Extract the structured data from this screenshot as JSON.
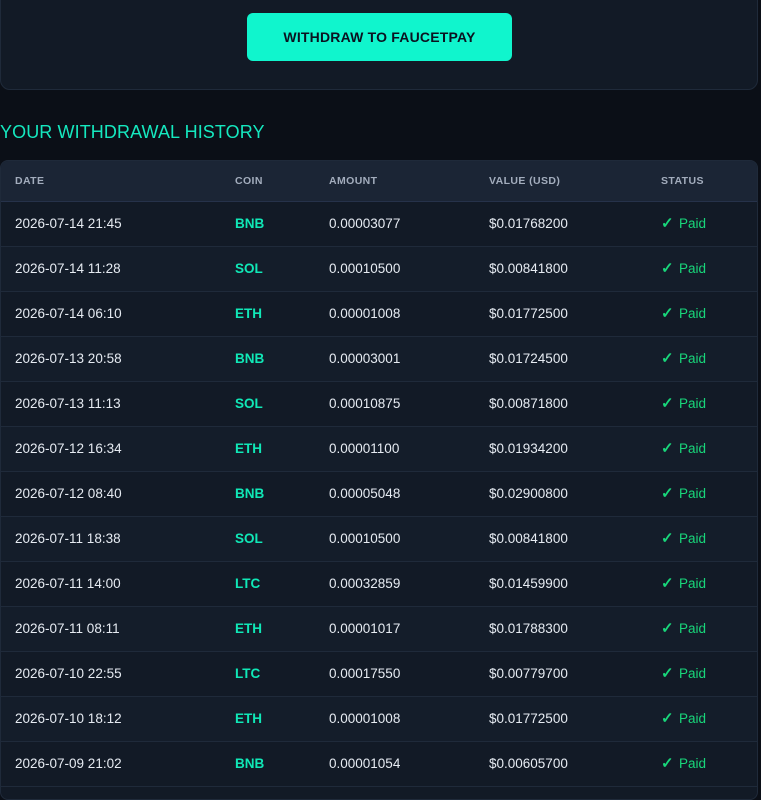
{
  "withdraw": {
    "button_label": "WITHDRAW TO FAUCETPAY"
  },
  "history": {
    "title": "YOUR WITHDRAWAL HISTORY",
    "columns": [
      "DATE",
      "COIN",
      "AMOUNT",
      "VALUE (USD)",
      "STATUS"
    ],
    "check_icon": "✓",
    "rows": [
      {
        "date": "2026-07-14 21:45",
        "coin": "BNB",
        "amount": "0.00003077",
        "value": "$0.01768200",
        "status": "Paid"
      },
      {
        "date": "2026-07-14 11:28",
        "coin": "SOL",
        "amount": "0.00010500",
        "value": "$0.00841800",
        "status": "Paid"
      },
      {
        "date": "2026-07-14 06:10",
        "coin": "ETH",
        "amount": "0.00001008",
        "value": "$0.01772500",
        "status": "Paid"
      },
      {
        "date": "2026-07-13 20:58",
        "coin": "BNB",
        "amount": "0.00003001",
        "value": "$0.01724500",
        "status": "Paid"
      },
      {
        "date": "2026-07-13 11:13",
        "coin": "SOL",
        "amount": "0.00010875",
        "value": "$0.00871800",
        "status": "Paid"
      },
      {
        "date": "2026-07-12 16:34",
        "coin": "ETH",
        "amount": "0.00001100",
        "value": "$0.01934200",
        "status": "Paid"
      },
      {
        "date": "2026-07-12 08:40",
        "coin": "BNB",
        "amount": "0.00005048",
        "value": "$0.02900800",
        "status": "Paid"
      },
      {
        "date": "2026-07-11 18:38",
        "coin": "SOL",
        "amount": "0.00010500",
        "value": "$0.00841800",
        "status": "Paid"
      },
      {
        "date": "2026-07-11 14:00",
        "coin": "LTC",
        "amount": "0.00032859",
        "value": "$0.01459900",
        "status": "Paid"
      },
      {
        "date": "2026-07-11 08:11",
        "coin": "ETH",
        "amount": "0.00001017",
        "value": "$0.01788300",
        "status": "Paid"
      },
      {
        "date": "2026-07-10 22:55",
        "coin": "LTC",
        "amount": "0.00017550",
        "value": "$0.00779700",
        "status": "Paid"
      },
      {
        "date": "2026-07-10 18:12",
        "coin": "ETH",
        "amount": "0.00001008",
        "value": "$0.01772500",
        "status": "Paid"
      },
      {
        "date": "2026-07-09 21:02",
        "coin": "BNB",
        "amount": "0.00001054",
        "value": "$0.00605700",
        "status": "Paid"
      }
    ]
  },
  "colors": {
    "accent": "#10f5cd",
    "coin": "#10e8b7",
    "paid": "#18d67a",
    "background": "#0b0f17",
    "card": "#121a26"
  }
}
